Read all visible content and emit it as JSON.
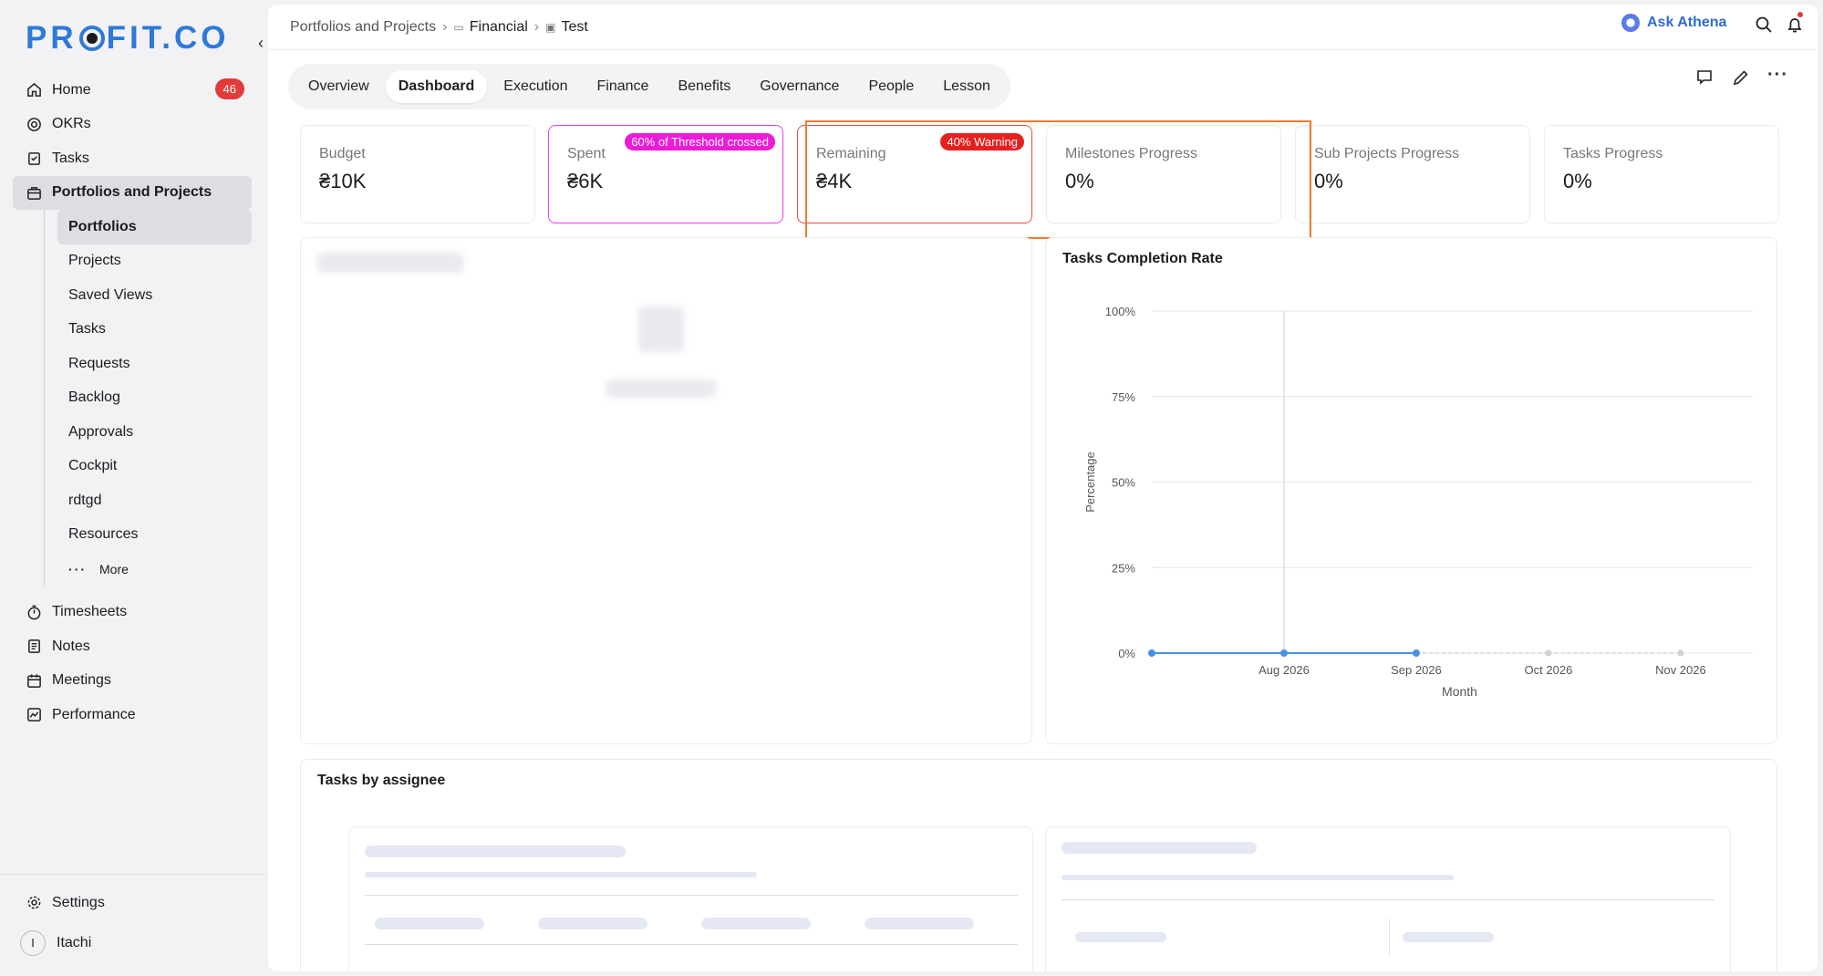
{
  "brand": {
    "logo_pre": "PR",
    "logo_post": "FIT.CO",
    "collapse_glyph": "‹"
  },
  "sidebar": {
    "items": [
      {
        "label": "Home",
        "icon": "home-icon",
        "badge": "46"
      },
      {
        "label": "OKRs",
        "icon": "target-icon"
      },
      {
        "label": "Tasks",
        "icon": "clipboard-icon"
      },
      {
        "label": "Portfolios and Projects",
        "icon": "briefcase-icon",
        "active": true
      }
    ],
    "sub_items": [
      {
        "label": "Portfolios",
        "active": true
      },
      {
        "label": "Projects"
      },
      {
        "label": "Saved Views"
      },
      {
        "label": "Tasks"
      },
      {
        "label": "Requests"
      },
      {
        "label": "Backlog"
      },
      {
        "label": "Approvals"
      },
      {
        "label": "Cockpit"
      },
      {
        "label": "rdtgd"
      },
      {
        "label": "Resources"
      }
    ],
    "more_label": "More",
    "more_glyph": "···",
    "items_after": [
      {
        "label": "Timesheets",
        "icon": "stopwatch-icon"
      },
      {
        "label": "Notes",
        "icon": "notes-icon"
      },
      {
        "label": "Meetings",
        "icon": "calendar-icon"
      },
      {
        "label": "Performance",
        "icon": "chart-icon"
      }
    ],
    "settings_label": "Settings",
    "user_initial": "I",
    "user_name": "Itachi"
  },
  "breadcrumb": {
    "root": "Portfolios and Projects",
    "mid": "Financial",
    "leaf": "Test",
    "sep": "›"
  },
  "header": {
    "ask_label": "Ask Athena",
    "search_glyph": "⌕",
    "bell_glyph": "🔔"
  },
  "tabs": [
    "Overview",
    "Dashboard",
    "Execution",
    "Finance",
    "Benefits",
    "Governance",
    "People",
    "Lesson"
  ],
  "active_tab": "Dashboard",
  "toolbar": {
    "comment_glyph": "🗨",
    "edit_glyph": "✎",
    "more_glyph": "···"
  },
  "cards": [
    {
      "label": "Budget",
      "value": "₴10K"
    },
    {
      "label": "Spent",
      "value": "₴6K",
      "pill": "60% of Threshold crossed"
    },
    {
      "label": "Remaining",
      "value": "₴4K",
      "pill": "40% Warning"
    },
    {
      "label": "Milestones Progress",
      "value": "0%"
    },
    {
      "label": "Sub Projects Progress",
      "value": "0%"
    },
    {
      "label": "Tasks Progress",
      "value": "0%"
    }
  ],
  "colors": {
    "accent": "#2f79d8",
    "spent_pill": "#ec1bd6",
    "warning_pill": "#e61f1f",
    "highlight": "#f07a2a",
    "line": "#4a90e2"
  },
  "completion_panel": {
    "title": "Tasks Completion Rate"
  },
  "assignee_panel": {
    "title": "Tasks by assignee"
  },
  "chart_data": {
    "type": "line",
    "title": "Tasks Completion Rate",
    "xlabel": "Month",
    "ylabel": "Percentage",
    "ylim": [
      0,
      100
    ],
    "yticks": [
      "0%",
      "25%",
      "50%",
      "75%",
      "100%"
    ],
    "x": [
      "",
      "Aug 2026",
      "Sep 2026",
      "Oct 2026",
      "Nov 2026"
    ],
    "series": [
      {
        "values": [
          0,
          0,
          0,
          0,
          0
        ]
      }
    ],
    "solid_points": 3,
    "grid": true
  }
}
